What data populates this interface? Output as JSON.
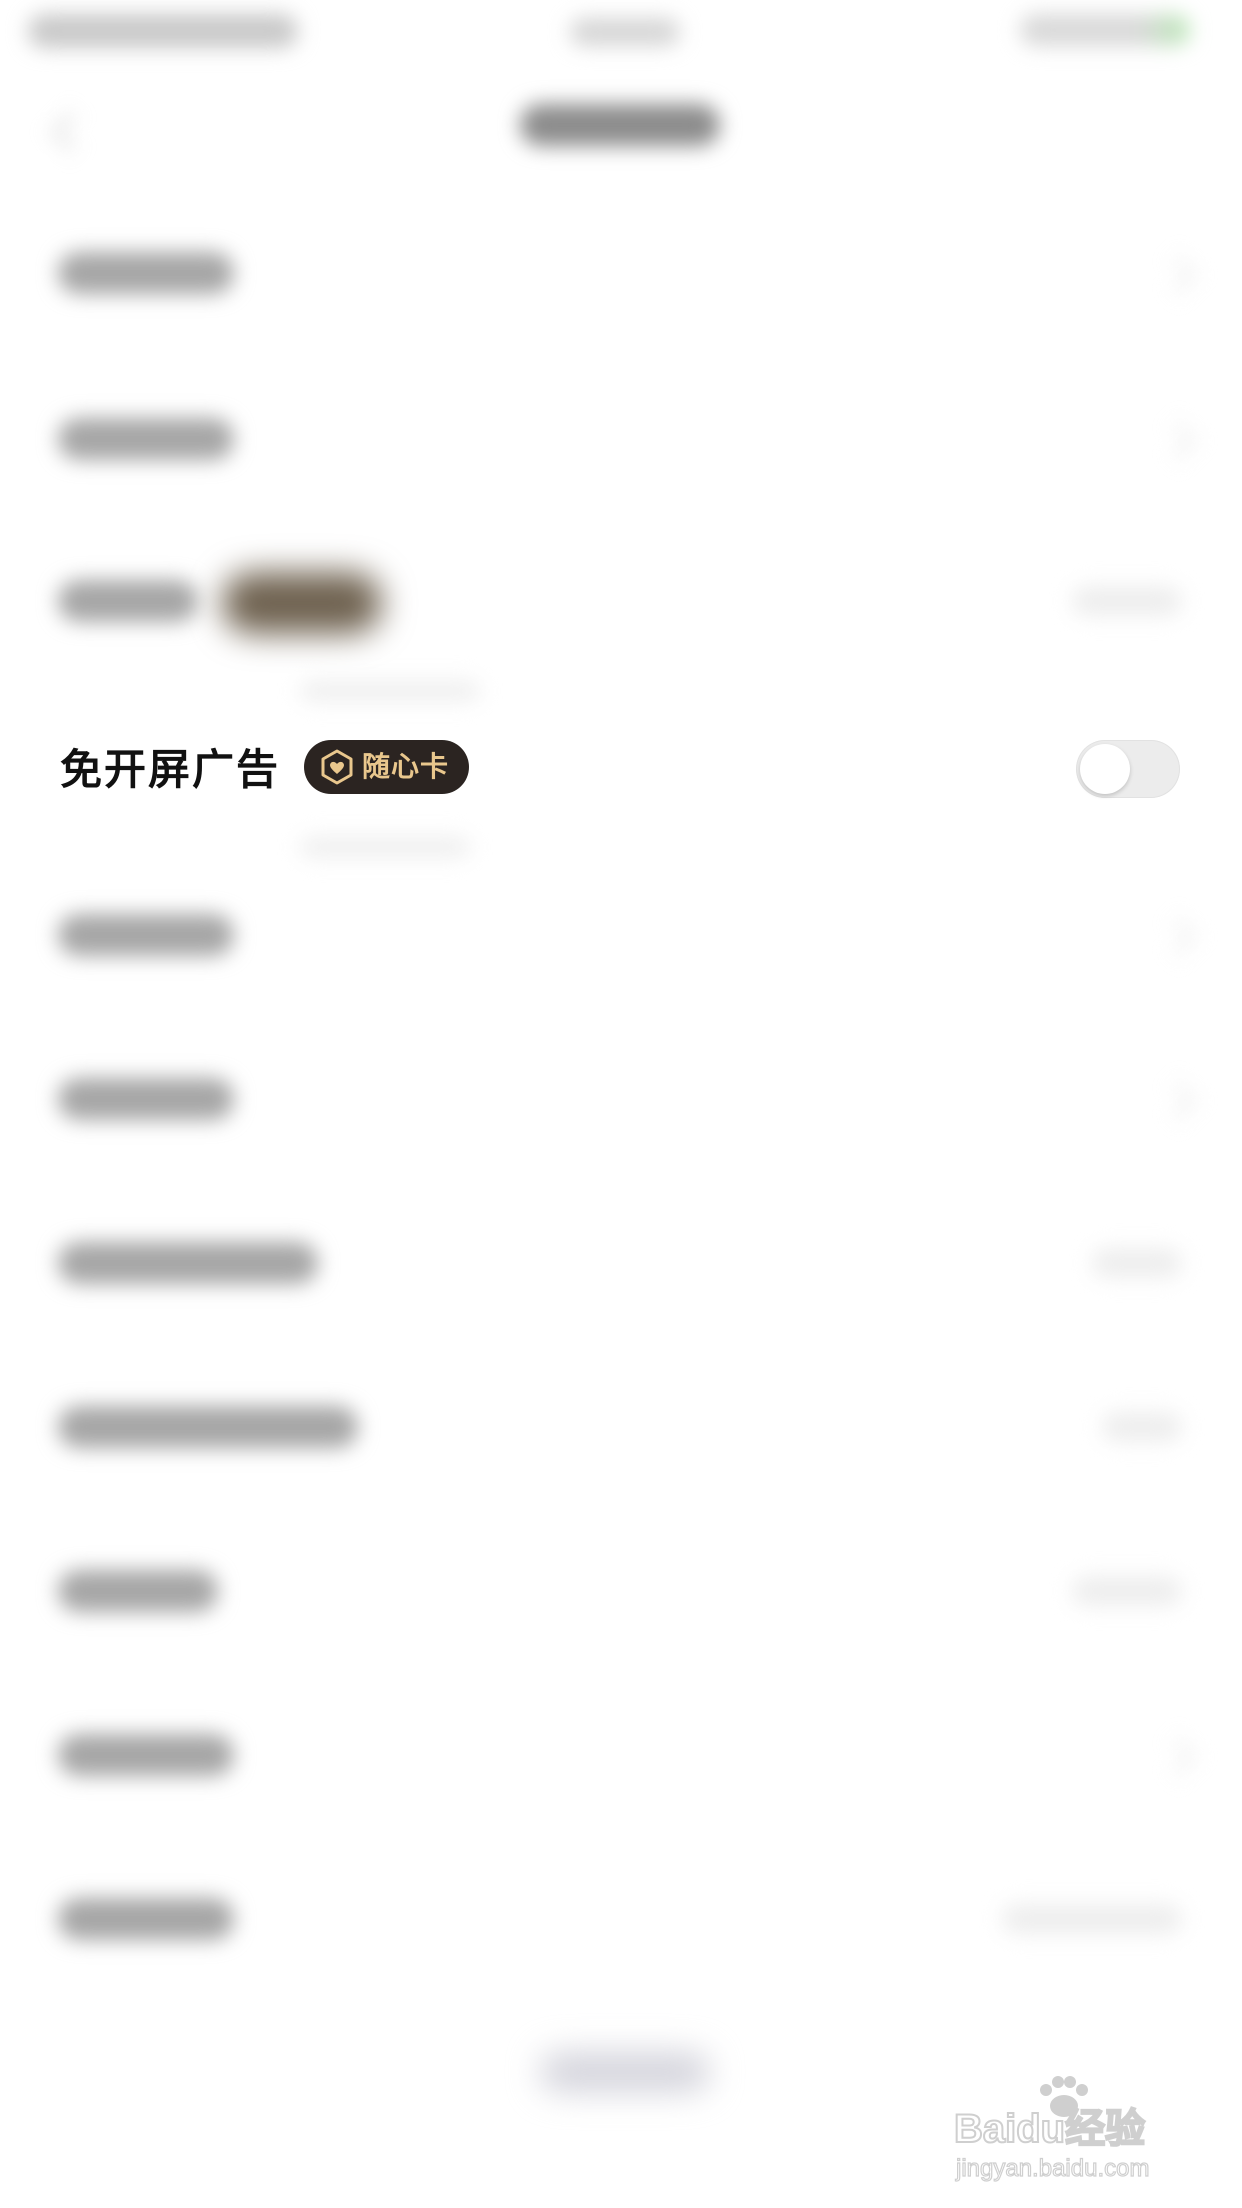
{
  "setting": {
    "label": "免开屏广告",
    "badge": "随心卡",
    "toggle_on": false
  },
  "colors": {
    "badge_bg": "#2b2421",
    "badge_text": "#e9c78d",
    "toggle_off_bg": "#ececec",
    "label_text": "#111111"
  },
  "icons": {
    "badge_icon": "hexagon-heart-icon",
    "watermark": "baidu-jingyan-watermark"
  },
  "watermark": {
    "brand": "Baidu经验",
    "url": "jingyan.baidu.com"
  }
}
